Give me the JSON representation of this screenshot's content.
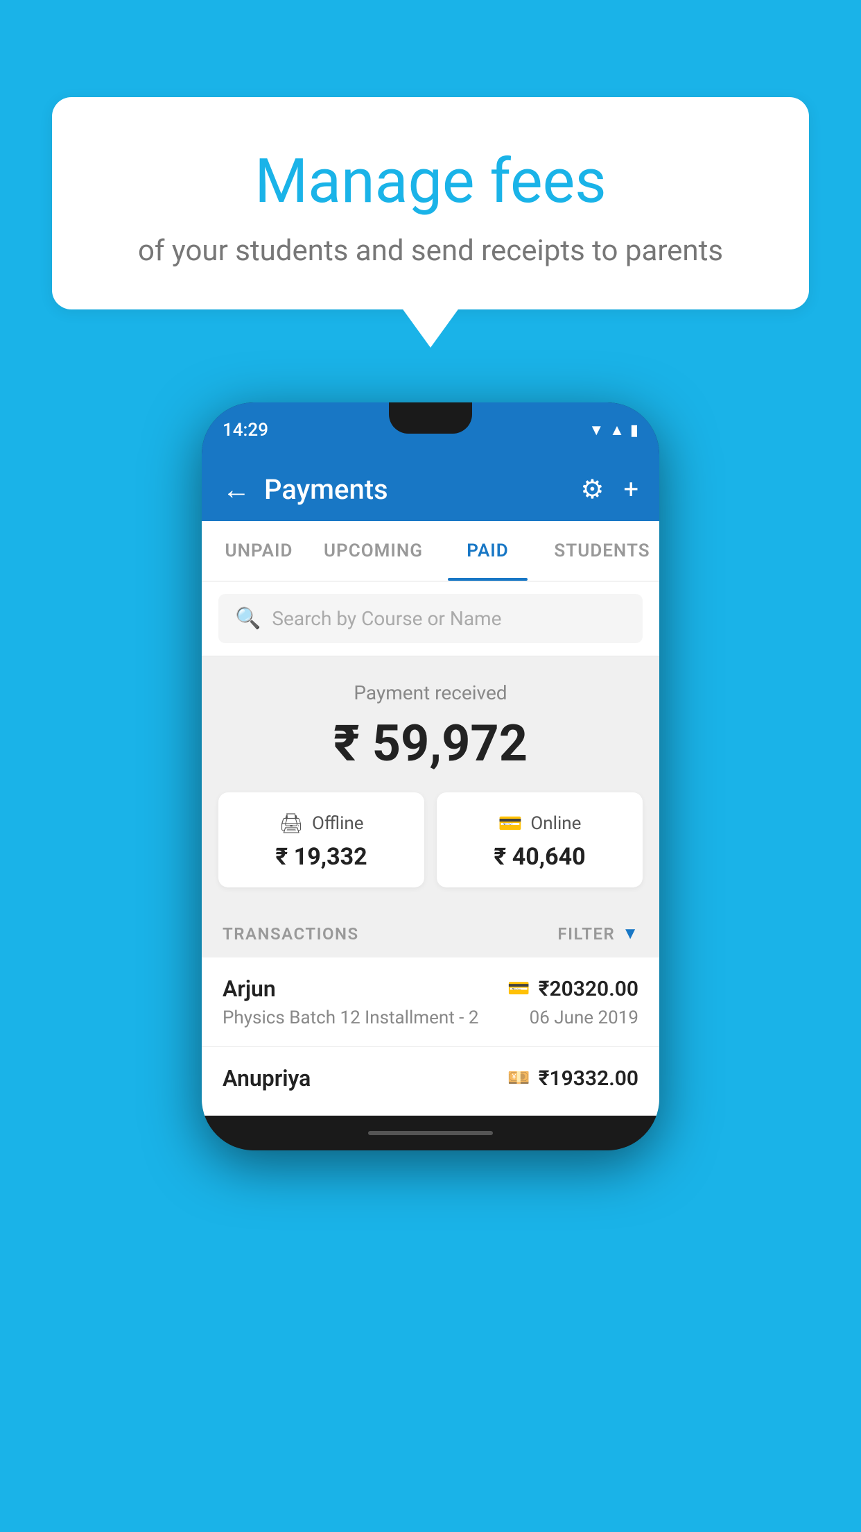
{
  "background_color": "#1ab3e8",
  "speech_bubble": {
    "title": "Manage fees",
    "subtitle": "of your students and send receipts to parents"
  },
  "phone": {
    "status_bar": {
      "time": "14:29"
    },
    "header": {
      "title": "Payments",
      "back_label": "←",
      "gear_label": "⚙",
      "plus_label": "+"
    },
    "tabs": [
      {
        "label": "UNPAID",
        "active": false
      },
      {
        "label": "UPCOMING",
        "active": false
      },
      {
        "label": "PAID",
        "active": true
      },
      {
        "label": "STUDENTS",
        "active": false
      }
    ],
    "search": {
      "placeholder": "Search by Course or Name"
    },
    "payment_summary": {
      "label": "Payment received",
      "amount": "₹ 59,972",
      "cards": [
        {
          "type": "Offline",
          "amount": "₹ 19,332",
          "icon": "💳"
        },
        {
          "type": "Online",
          "amount": "₹ 40,640",
          "icon": "💳"
        }
      ]
    },
    "transactions": {
      "section_label": "TRANSACTIONS",
      "filter_label": "FILTER",
      "rows": [
        {
          "name": "Arjun",
          "course": "Physics Batch 12 Installment - 2",
          "amount": "₹20320.00",
          "date": "06 June 2019",
          "type_icon": "💳"
        },
        {
          "name": "Anupriya",
          "course": "",
          "amount": "₹19332.00",
          "date": "",
          "type_icon": "💴"
        }
      ]
    }
  }
}
